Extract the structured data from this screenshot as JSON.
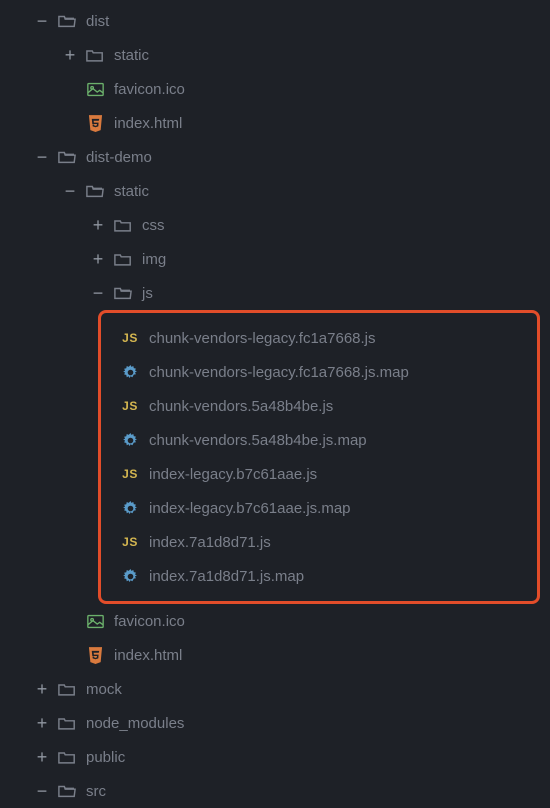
{
  "tree": {
    "dist": {
      "label": "dist",
      "static": {
        "label": "static"
      },
      "favicon": {
        "label": "favicon.ico"
      },
      "index": {
        "label": "index.html"
      }
    },
    "distdemo": {
      "label": "dist-demo",
      "static": {
        "label": "static",
        "css": {
          "label": "css"
        },
        "img": {
          "label": "img"
        },
        "js": {
          "label": "js",
          "files": [
            "chunk-vendors-legacy.fc1a7668.js",
            "chunk-vendors-legacy.fc1a7668.js.map",
            "chunk-vendors.5a48b4be.js",
            "chunk-vendors.5a48b4be.js.map",
            "index-legacy.b7c61aae.js",
            "index-legacy.b7c61aae.js.map",
            "index.7a1d8d71.js",
            "index.7a1d8d71.js.map"
          ]
        }
      },
      "favicon": {
        "label": "favicon.ico"
      },
      "index": {
        "label": "index.html"
      }
    },
    "mock": {
      "label": "mock"
    },
    "node_modules": {
      "label": "node_modules"
    },
    "public": {
      "label": "public"
    },
    "src": {
      "label": "src"
    }
  }
}
